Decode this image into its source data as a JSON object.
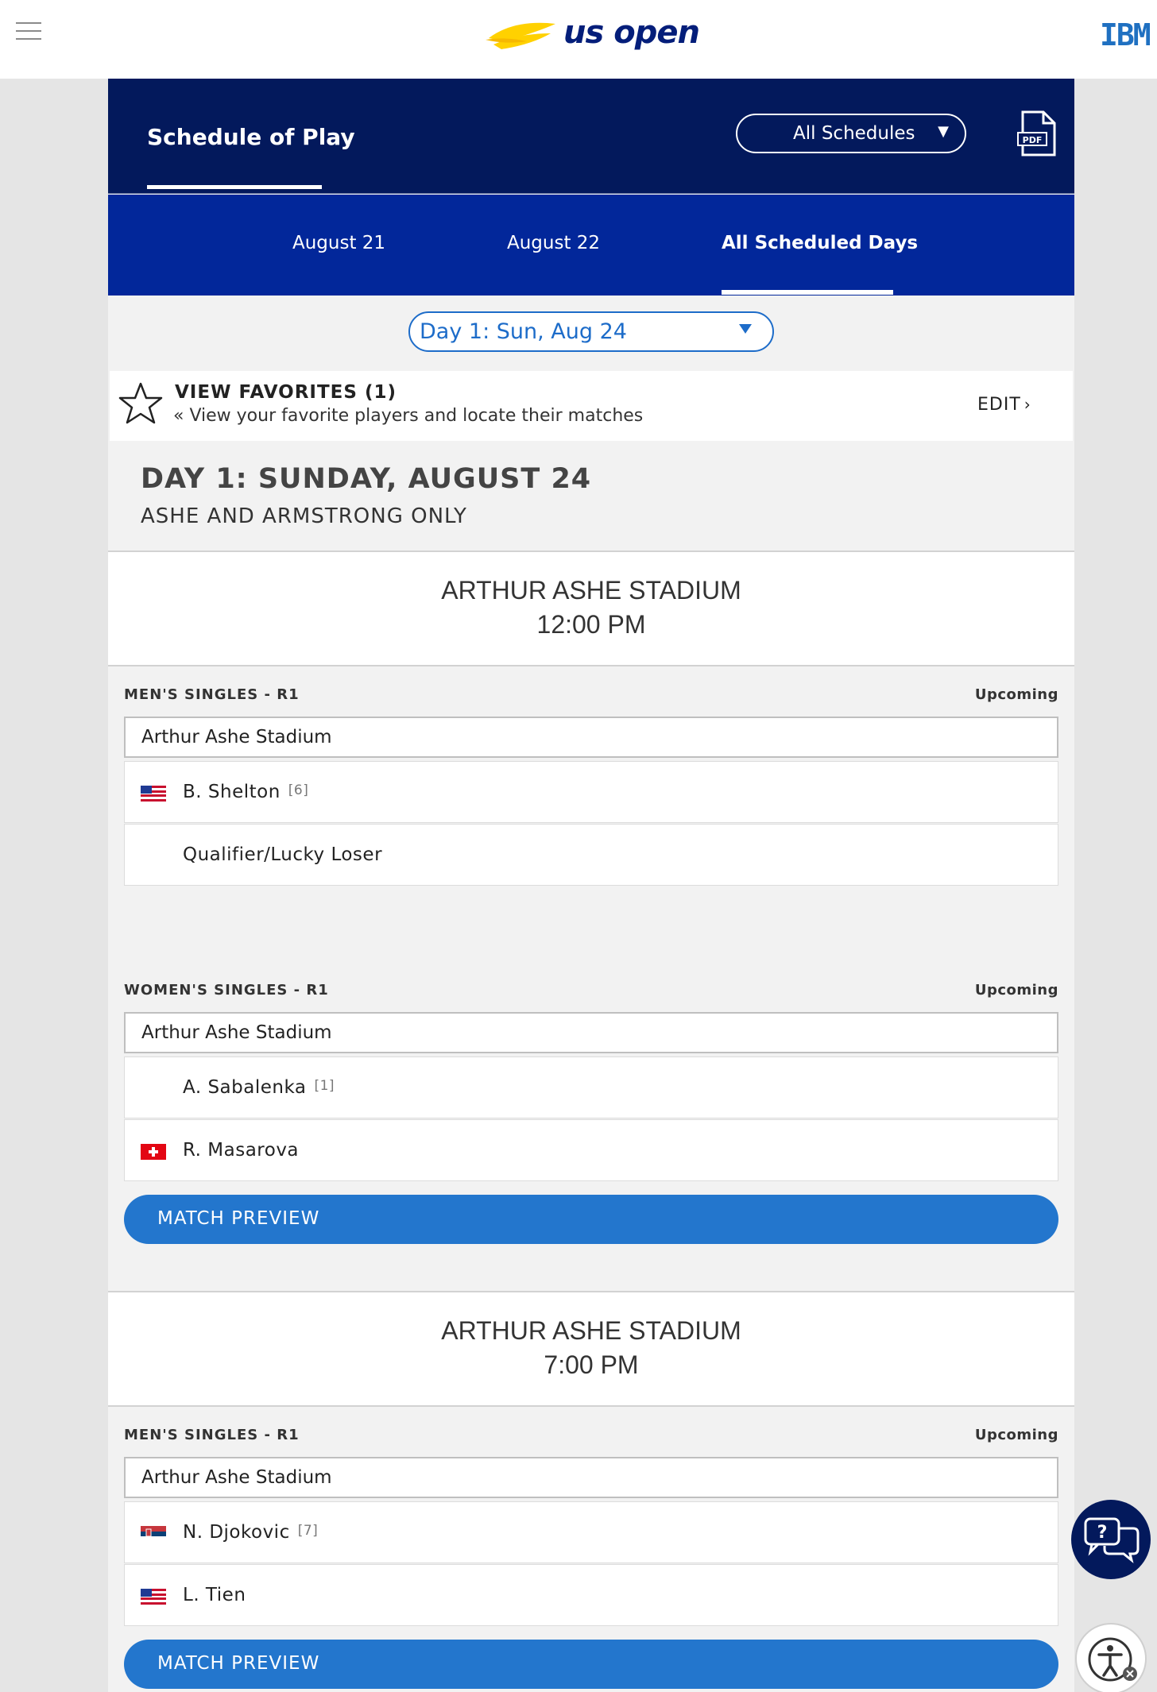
{
  "header": {
    "logo_text": "us open",
    "sponsor": "IBM"
  },
  "schedule_header": {
    "title": "Schedule of Play",
    "dropdown_value": "All Schedules",
    "pdf_label": "PDF"
  },
  "date_tabs": [
    {
      "label": "August 21"
    },
    {
      "label": "August 22"
    },
    {
      "label": "All Scheduled Days"
    }
  ],
  "day_selector": {
    "value": "Day 1: Sun, Aug 24"
  },
  "favorites": {
    "title": "VIEW FAVORITES (1)",
    "subtitle": "« View your favorite players and locate their matches",
    "edit_label": "EDIT"
  },
  "day": {
    "heading": "DAY 1: SUNDAY, AUGUST 24",
    "subheading": "ASHE AND ARMSTRONG ONLY"
  },
  "sessions": [
    {
      "stadium": "ARTHUR ASHE STADIUM",
      "time": "12:00 PM",
      "matches": [
        {
          "label": "MEN'S SINGLES - R1",
          "status": "Upcoming",
          "court": "Arthur Ashe Stadium",
          "players": [
            {
              "name": "B. Shelton",
              "seed": "[6]",
              "flag": "usa"
            },
            {
              "name": "Qualifier/Lucky Loser",
              "seed": "",
              "flag": ""
            }
          ]
        },
        {
          "label": "WOMEN'S SINGLES - R1",
          "status": "Upcoming",
          "court": "Arthur Ashe Stadium",
          "players": [
            {
              "name": "A. Sabalenka",
              "seed": "[1]",
              "flag": ""
            },
            {
              "name": "R. Masarova",
              "seed": "",
              "flag": "switzerland"
            }
          ],
          "button": "MATCH PREVIEW"
        }
      ]
    },
    {
      "stadium": "ARTHUR ASHE STADIUM",
      "time": "7:00 PM",
      "matches": [
        {
          "label": "MEN'S SINGLES - R1",
          "status": "Upcoming",
          "court": "Arthur Ashe Stadium",
          "players": [
            {
              "name": "N. Djokovic",
              "seed": "[7]",
              "flag": "serbia"
            },
            {
              "name": "L. Tien",
              "seed": "",
              "flag": "usa"
            }
          ],
          "button": "MATCH PREVIEW"
        }
      ]
    }
  ],
  "colors": {
    "navy": "#03195c",
    "royal_blue": "#02279a",
    "accent_blue": "#2376cd",
    "logo_yellow": "#ffd100"
  },
  "icons": {
    "menu": "hamburger-icon",
    "pdf": "pdf-icon",
    "favorite": "star-icon",
    "chat": "chat-icon",
    "accessibility": "accessibility-icon"
  }
}
